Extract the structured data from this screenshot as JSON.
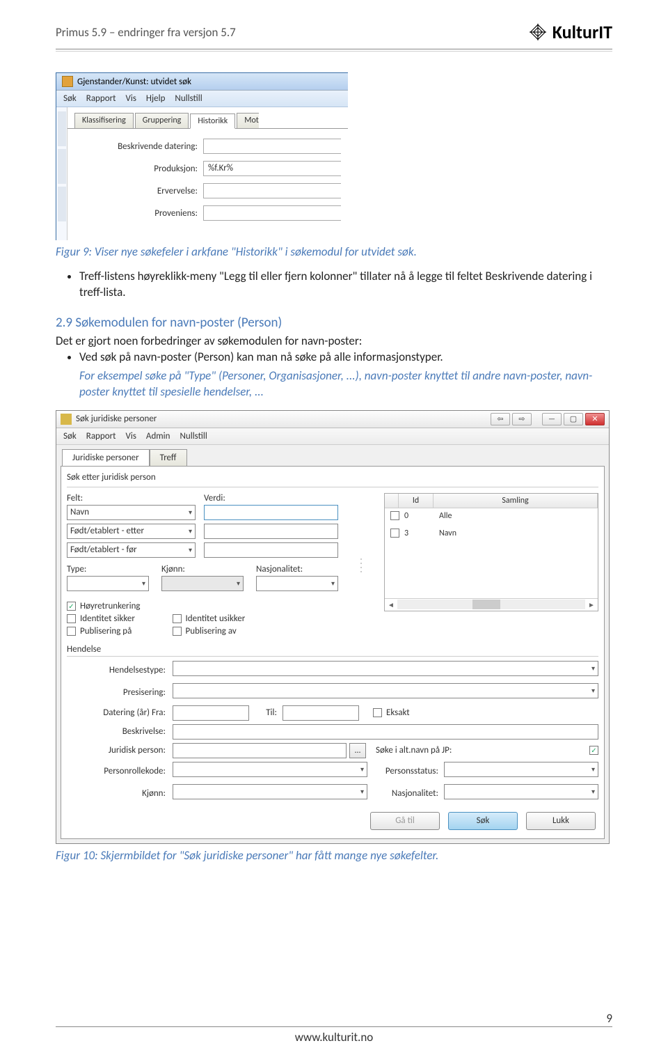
{
  "header": {
    "doc_title": "Primus 5.9 – endringer fra versjon 5.7",
    "brand": "KulturIT"
  },
  "screenshot1": {
    "window_title": "Gjenstander/Kunst: utvidet søk",
    "menu": [
      "Søk",
      "Rapport",
      "Vis",
      "Hjelp",
      "Nullstill"
    ],
    "tabs": [
      "Klassifisering",
      "Gruppering",
      "Historikk",
      "Mot"
    ],
    "fields": {
      "beskrivende": {
        "label": "Beskrivende datering:",
        "value": ""
      },
      "produksjon": {
        "label": "Produksjon:",
        "value": "%f.Kr%"
      },
      "ervervelse": {
        "label": "Ervervelse:",
        "value": ""
      },
      "proveniens": {
        "label": "Proveniens:",
        "value": ""
      }
    }
  },
  "caption1": "Figur 9: Viser nye søkefeler i arkfane \"Historikk\" i søkemodul for utvidet søk.",
  "bullet1": "Treff-listens høyreklikk-meny \"Legg til eller fjern kolonner\" tillater nå å legge til feltet Beskrivende datering i treff-lista.",
  "section_heading": "2.9 Søkemodulen for navn-poster (Person)",
  "intro_text": "Det er gjort noen forbedringer av søkemodulen for navn-poster:",
  "bullet2": "Ved søk på navn-poster (Person) kan man nå søke på alle informasjonstyper.",
  "italic_text": "For eksempel søke på \"Type\" (Personer, Organisasjoner, ...), navn-poster knyttet til andre navn-poster, navn-poster knyttet til spesielle hendelser, ...",
  "screenshot2": {
    "window_title": "Søk juridiske personer",
    "menu": [
      "Søk",
      "Rapport",
      "Vis",
      "Admin",
      "Nullstill"
    ],
    "tabs": [
      "Juridiske personer",
      "Treff"
    ],
    "group_label": "Søk etter juridisk person",
    "felt_label": "Felt:",
    "verdi_label": "Verdi:",
    "felt_options": [
      "Navn",
      "Født/etablert - etter",
      "Født/etablert - før"
    ],
    "type_label": "Type:",
    "kjonn_label": "Kjønn:",
    "nasjonalitet_label": "Nasjonalitet:",
    "checkboxes": {
      "hoyretrunkering": "Høyretrunkering",
      "identitet_sikker": "Identitet sikker",
      "identitet_usikker": "Identitet usikker",
      "publisering_pa": "Publisering på",
      "publisering_av": "Publisering av"
    },
    "table": {
      "headers": [
        "",
        "Id",
        "Samling"
      ],
      "rows": [
        {
          "id": "0",
          "name": "Alle"
        },
        {
          "id": "3",
          "name": "Navn"
        }
      ]
    },
    "hendelse_label": "Hendelse",
    "hendelse_fields": {
      "hendelsestype": "Hendelsestype:",
      "presisering": "Presisering:",
      "datering_fra": "Datering (år) Fra:",
      "til": "Til:",
      "eksakt": "Eksakt",
      "beskrivelse": "Beskrivelse:",
      "juridisk_person": "Juridisk person:",
      "soke_alt_navn": "Søke i alt.navn på JP:",
      "personrollekode": "Personrollekode:",
      "personsstatus": "Personsstatus:",
      "kjonn2": "Kjønn:",
      "nasjonalitet2": "Nasjonalitet:"
    },
    "buttons": {
      "gaatil": "Gå til",
      "sok": "Søk",
      "lukk": "Lukk"
    }
  },
  "caption2": "Figur 10: Skjermbildet for \"Søk juridiske personer\" har fått mange nye søkefelter.",
  "footer": {
    "url": "www.kulturit.no",
    "page": "9"
  }
}
